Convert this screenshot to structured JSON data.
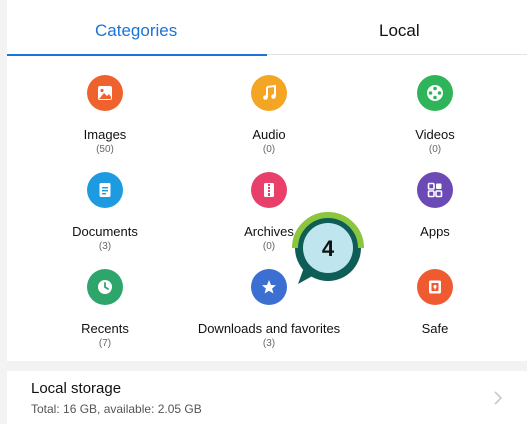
{
  "tabs": {
    "categories": "Categories",
    "local": "Local"
  },
  "categories": [
    {
      "label": "Images",
      "count": "(50)",
      "color": "#f0622d",
      "icon": "image-icon"
    },
    {
      "label": "Audio",
      "count": "(0)",
      "color": "#f5a524",
      "icon": "music-note-icon"
    },
    {
      "label": "Videos",
      "count": "(0)",
      "color": "#2fb45a",
      "icon": "film-reel-icon"
    },
    {
      "label": "Documents",
      "count": "(3)",
      "color": "#1e9be0",
      "icon": "document-icon"
    },
    {
      "label": "Archives",
      "count": "(0)",
      "color": "#e8406b",
      "icon": "archive-icon"
    },
    {
      "label": "Apps",
      "count": "",
      "color": "#6c4ab6",
      "icon": "apps-grid-icon"
    },
    {
      "label": "Recents",
      "count": "(7)",
      "color": "#2ea66b",
      "icon": "clock-icon"
    },
    {
      "label": "Downloads and favorites",
      "count": "(3)",
      "color": "#3b6fd1",
      "icon": "star-icon"
    },
    {
      "label": "Safe",
      "count": "",
      "color": "#ef5a30",
      "icon": "safe-icon"
    }
  ],
  "storage": {
    "title": "Local storage",
    "subtitle": "Total: 16 GB, available: 2.05 GB"
  },
  "badge": {
    "number": "4"
  }
}
